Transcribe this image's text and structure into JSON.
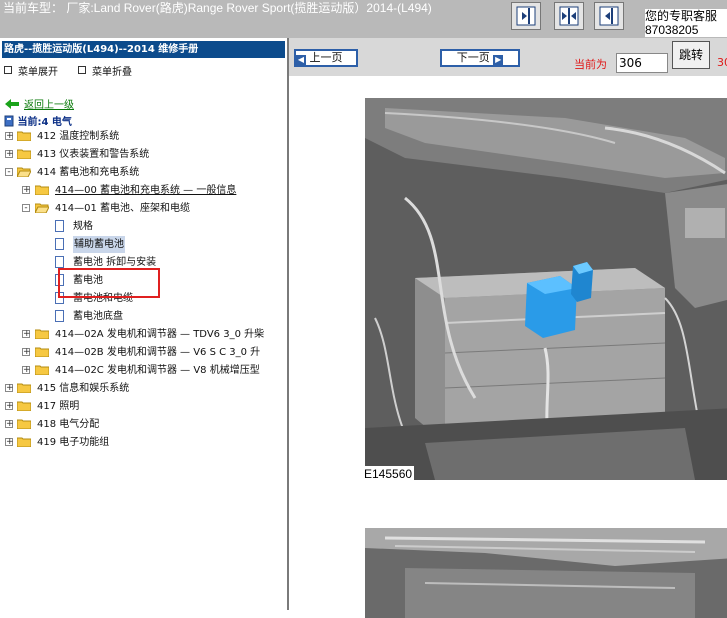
{
  "header": {
    "car_label": "当前车型： 厂家:Land Rover(路虎)Range Rover Sport(揽胜运动版）2014-(L494)",
    "contact_line1": "您的专职客服",
    "contact_line2": "87038205",
    "nav_buttons": [
      "expand-left-icon",
      "split-view-icon",
      "collapse-left-icon"
    ]
  },
  "sidebar": {
    "manual_title": "路虎--揽胜运动版(L494)--2014 维修手册",
    "expand_menu": "菜单展开",
    "collapse_menu": "菜单折叠",
    "back_link": "返回上一级",
    "current": "当前:4 电气",
    "tree": [
      {
        "label": "412 温度控制系统",
        "type": "folder",
        "toggle": "+"
      },
      {
        "label": "413 仪表装置和警告系统",
        "type": "folder",
        "toggle": "+"
      },
      {
        "label": "414 蓄电池和充电系统",
        "type": "folder",
        "toggle": "-"
      },
      {
        "label": "414—00 蓄电池和充电系统 — 一般信息",
        "type": "folder",
        "toggle": "+"
      },
      {
        "label": "414—01 蓄电池、座架和电缆",
        "type": "folder",
        "toggle": "-"
      },
      {
        "label": "规格",
        "type": "page"
      },
      {
        "label": "辅助蓄电池",
        "type": "page",
        "selected": true
      },
      {
        "label": "蓄电池 拆卸与安装",
        "type": "page"
      },
      {
        "label": "蓄电池",
        "type": "page"
      },
      {
        "label": "蓄电池和电缆",
        "type": "page"
      },
      {
        "label": "蓄电池底盘",
        "type": "page"
      },
      {
        "label": "414—02A 发电机和调节器 — TDV6 3_0 升柴",
        "type": "folder",
        "toggle": "+"
      },
      {
        "label": "414—02B 发电机和调节器 — V6 S C 3_0 升",
        "type": "folder",
        "toggle": "+"
      },
      {
        "label": "414—02C 发电机和调节器 — V8 机械增压型",
        "type": "folder",
        "toggle": "+"
      },
      {
        "label": "415 信息和娱乐系统",
        "type": "folder",
        "toggle": "+"
      },
      {
        "label": "417 照明",
        "type": "folder",
        "toggle": "+"
      },
      {
        "label": "418 电气分配",
        "type": "folder",
        "toggle": "+"
      },
      {
        "label": "419 电子功能组",
        "type": "folder",
        "toggle": "+"
      }
    ]
  },
  "content": {
    "prev_label": "上一页",
    "next_label": "下一页",
    "current_page_label": "当前为",
    "current_page_value": "306",
    "jump_label": "跳转",
    "cut_text": "30",
    "figure_caption": "E145560"
  },
  "colors": {
    "header_bg": "#b9b9b9",
    "title_bar": "#0c4b8c",
    "highlight_box": "#e02020",
    "battery_part": "#2a9be8"
  }
}
